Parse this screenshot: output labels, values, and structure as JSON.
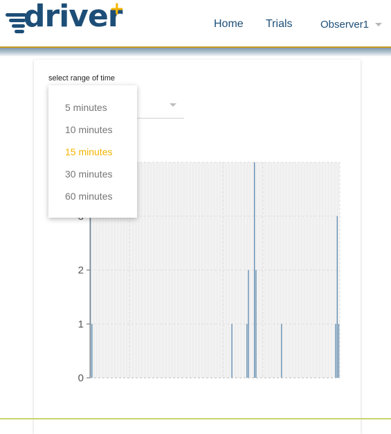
{
  "brand": {
    "name": "driver",
    "plus": "+"
  },
  "nav": {
    "home": "Home",
    "trials": "Trials",
    "user": "Observer1"
  },
  "filter": {
    "label": "select range of time",
    "options": [
      "5 minutes",
      "10 minutes",
      "15 minutes",
      "30 minutes",
      "60 minutes"
    ],
    "selected": "15 minutes"
  },
  "colors": {
    "brand": "#1d4e77",
    "accent": "#f4b400",
    "bar": "#5b88ad"
  },
  "chart_data": {
    "type": "bar",
    "ylim": [
      0,
      4
    ],
    "y_ticks": [
      "0",
      "1",
      "2",
      "3"
    ],
    "grid": true,
    "values": [
      4,
      1,
      0,
      0,
      0,
      0,
      0,
      0,
      0,
      0,
      0,
      0,
      0,
      0,
      0,
      0,
      0,
      0,
      0,
      0,
      0,
      0,
      0,
      0,
      0,
      0,
      0,
      0,
      0,
      0,
      0,
      0,
      0,
      0,
      0,
      0,
      0,
      0,
      0,
      0,
      0,
      0,
      0,
      0,
      0,
      0,
      0,
      0,
      0,
      0,
      0,
      0,
      0,
      0,
      0,
      0,
      0,
      0,
      0,
      0,
      0,
      0,
      0,
      0,
      0,
      0,
      0,
      0,
      0,
      0,
      0,
      0,
      0,
      0,
      0,
      0,
      0,
      0,
      0,
      0,
      0,
      0,
      0,
      0,
      0,
      0,
      0,
      0,
      0,
      0,
      0,
      0,
      0,
      0,
      1,
      0,
      0,
      0,
      0,
      0,
      0,
      0,
      0,
      0,
      1,
      2,
      0,
      0,
      0,
      4,
      2,
      0,
      0,
      0,
      0,
      0,
      0,
      0,
      0,
      0,
      0,
      0,
      0,
      0,
      0,
      0,
      0,
      1,
      0,
      0,
      0,
      0,
      0,
      0,
      0,
      0,
      0,
      0,
      0,
      0,
      0,
      0,
      0,
      0,
      0,
      0,
      0,
      0,
      0,
      0,
      0,
      0,
      0,
      0,
      0,
      0,
      0,
      0,
      0,
      0,
      0,
      0,
      0,
      1,
      3,
      1
    ]
  }
}
